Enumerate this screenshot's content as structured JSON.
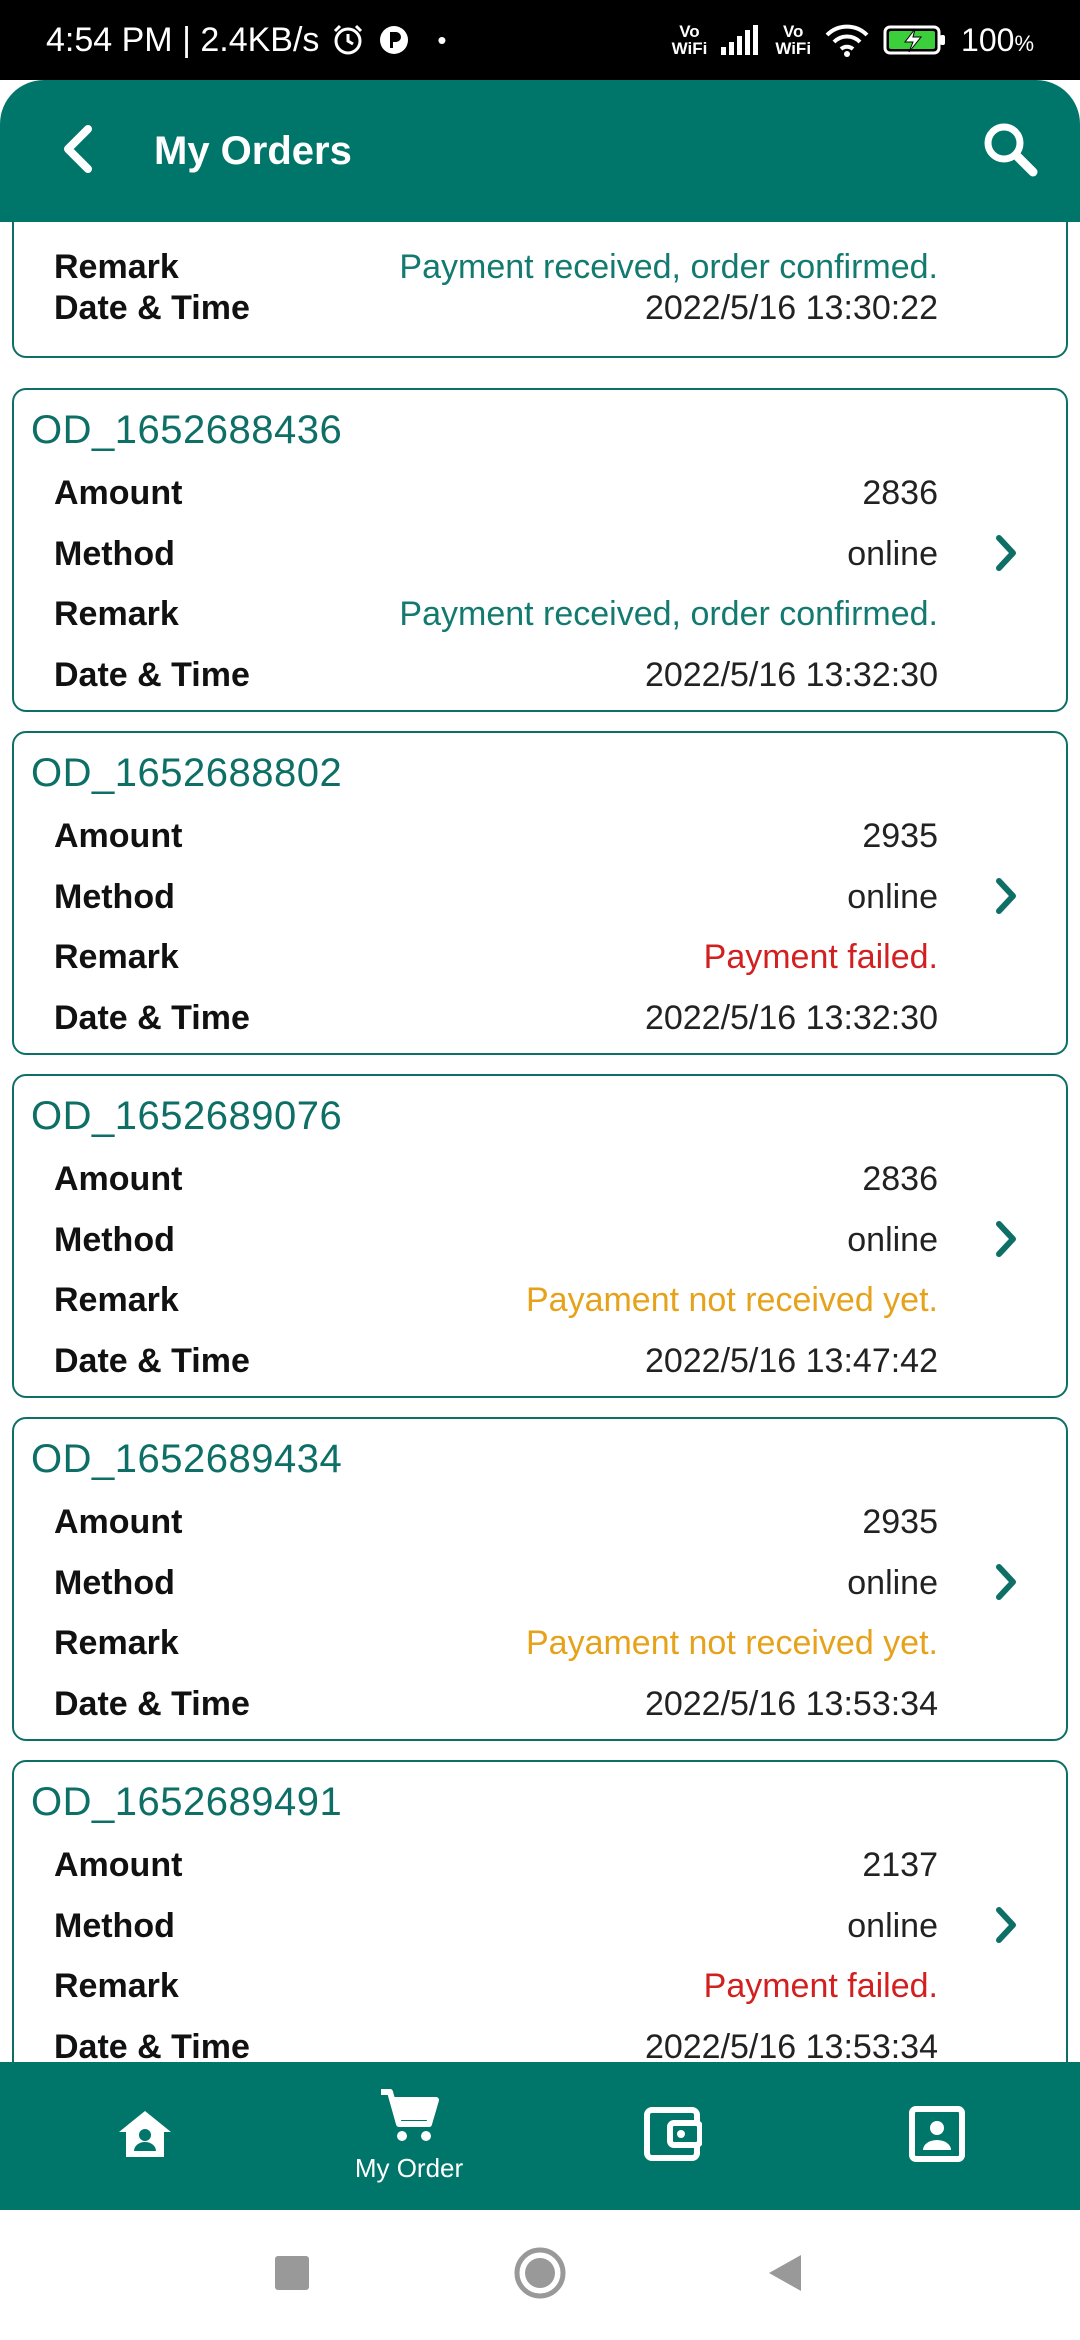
{
  "status_bar": {
    "time_speed": "4:54 PM | 2.4KB/s",
    "dot": "•",
    "vo_wifi_1_top": "Vo",
    "vo_wifi_1_bottom": "WiFi",
    "vo_wifi_2_top": "Vo",
    "vo_wifi_2_bottom": "WiFi",
    "battery": "100",
    "battery_unit": "%"
  },
  "header": {
    "title": "My Orders"
  },
  "orders": {
    "partial": {
      "remark_label": "Remark",
      "remark": "Payment received, order confirmed.",
      "datetime_label": "Date & Time",
      "datetime": "2022/5/16 13:30:22"
    },
    "o1": {
      "id": "OD_1652688436",
      "amount_label": "Amount",
      "amount": "2836",
      "method_label": "Method",
      "method": "online",
      "remark_label": "Remark",
      "remark": "Payment received, order confirmed.",
      "datetime_label": "Date & Time",
      "datetime": "2022/5/16 13:32:30"
    },
    "o2": {
      "id": "OD_1652688802",
      "amount_label": "Amount",
      "amount": "2935",
      "method_label": "Method",
      "method": "online",
      "remark_label": "Remark",
      "remark": "Payment failed.",
      "datetime_label": "Date & Time",
      "datetime": "2022/5/16 13:32:30"
    },
    "o3": {
      "id": "OD_1652689076",
      "amount_label": "Amount",
      "amount": "2836",
      "method_label": "Method",
      "method": "online",
      "remark_label": "Remark",
      "remark": "Payament not received yet.",
      "datetime_label": "Date & Time",
      "datetime": "2022/5/16 13:47:42"
    },
    "o4": {
      "id": "OD_1652689434",
      "amount_label": "Amount",
      "amount": "2935",
      "method_label": "Method",
      "method": "online",
      "remark_label": "Remark",
      "remark": "Payament not received yet.",
      "datetime_label": "Date & Time",
      "datetime": "2022/5/16 13:53:34"
    },
    "o5": {
      "id": "OD_1652689491",
      "amount_label": "Amount",
      "amount": "2137",
      "method_label": "Method",
      "method": "online",
      "remark_label": "Remark",
      "remark": "Payment failed.",
      "datetime_label": "Date & Time",
      "datetime": "2022/5/16 13:53:34"
    }
  },
  "bottom_nav": {
    "my_order_label": "My Order"
  },
  "colors": {
    "primary": "#00756a",
    "accent_text": "#0d6f66",
    "status_confirmed": "#137a70",
    "status_failed": "#d21f1f",
    "status_pending": "#e5a21a"
  },
  "icons": {
    "back": "back-arrow-icon",
    "search": "search-icon",
    "chevron": "chevron-right-icon",
    "home": "home-icon",
    "cart": "cart-icon",
    "wallet": "wallet-icon",
    "profile": "profile-icon"
  }
}
